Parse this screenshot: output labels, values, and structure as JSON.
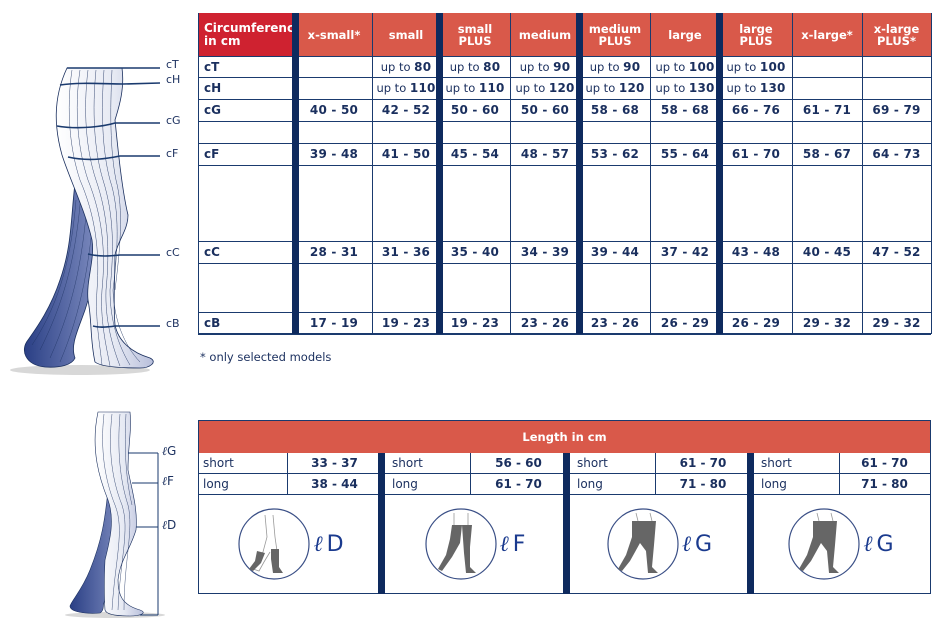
{
  "circumference_table": {
    "header_label": [
      "Circumference",
      "in cm"
    ],
    "sizes": [
      {
        "name": [
          "x-small*"
        ]
      },
      {
        "name": [
          "small"
        ]
      },
      {
        "name": [
          "small",
          "PLUS"
        ]
      },
      {
        "name": [
          "medium"
        ]
      },
      {
        "name": [
          "medium",
          "PLUS"
        ]
      },
      {
        "name": [
          "large"
        ]
      },
      {
        "name": [
          "large",
          "PLUS"
        ]
      },
      {
        "name": [
          "x-large*"
        ]
      },
      {
        "name": [
          "x-large",
          "PLUS*"
        ]
      }
    ],
    "rows": [
      {
        "label": "cT",
        "values": [
          "",
          "80",
          "80",
          "90",
          "90",
          "100",
          "100",
          "",
          ""
        ],
        "prefix": "up to "
      },
      {
        "label": "cH",
        "values": [
          "",
          "110",
          "110",
          "120",
          "120",
          "130",
          "130",
          "",
          ""
        ],
        "prefix": "up to "
      },
      {
        "label": "cG",
        "values": [
          "40 - 50",
          "42 - 52",
          "50 - 60",
          "50 - 60",
          "58 - 68",
          "58 - 68",
          "66 - 76",
          "61 - 71",
          "69 - 79"
        ]
      },
      {
        "label": "",
        "values": [
          "",
          "",
          "",
          "",
          "",
          "",
          "",
          "",
          ""
        ]
      },
      {
        "label": "cF",
        "values": [
          "39 - 48",
          "41 - 50",
          "45 - 54",
          "48 - 57",
          "53 - 62",
          "55 - 64",
          "61 - 70",
          "58 - 67",
          "64 - 73"
        ]
      },
      {
        "label": "",
        "values": [
          "",
          "",
          "",
          "",
          "",
          "",
          "",
          "",
          ""
        ]
      },
      {
        "label": "cC",
        "values": [
          "28 - 31",
          "31 - 36",
          "35 - 40",
          "34 - 39",
          "39 - 44",
          "37 - 42",
          "43 - 48",
          "40 - 45",
          "47 - 52"
        ]
      },
      {
        "label": "",
        "values": [
          "",
          "",
          "",
          "",
          "",
          "",
          "",
          "",
          ""
        ]
      },
      {
        "label": "cB",
        "values": [
          "17 - 19",
          "19 - 23",
          "19 - 23",
          "23 - 26",
          "23 - 26",
          "26 - 29",
          "26 - 29",
          "29 - 32",
          "29 - 32"
        ]
      }
    ],
    "footnote": "* only selected models"
  },
  "leg_top_labels": [
    "cT",
    "cH",
    "cG",
    "cF",
    "cC",
    "cB"
  ],
  "leg_bottom_labels": [
    "G",
    "F",
    "D"
  ],
  "length_table": {
    "header": "Length in cm",
    "groups": [
      {
        "short": "33 - 37",
        "long": "38 - 44",
        "code": "D"
      },
      {
        "short": "56 - 60",
        "long": "61 - 70",
        "code": "F"
      },
      {
        "short": "61 - 70",
        "long": "71 - 80",
        "code": "G"
      },
      {
        "short": "61 - 70",
        "long": "71 - 80",
        "code": "G"
      }
    ],
    "short_label": "short",
    "long_label": "long",
    "ell_symbol": "ℓ"
  },
  "colors": {
    "header_red": "#cf2230",
    "header_coral": "#d9594a",
    "navy": "#0e2a5e",
    "text_navy": "#1a2f5e"
  }
}
